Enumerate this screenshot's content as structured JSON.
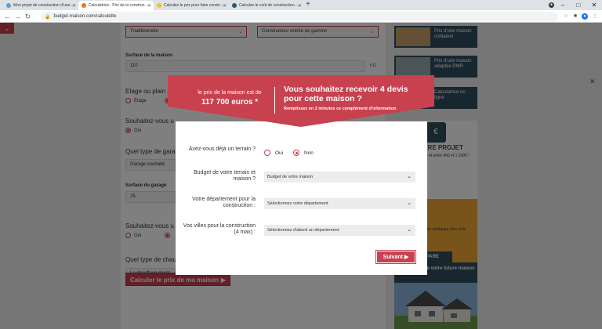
{
  "browser": {
    "tabs": [
      {
        "title": "Mon projet de construction d'une..."
      },
      {
        "title": "Calculatrice : Prix de la construc..."
      },
      {
        "title": "Calculez le prix pour faire constr..."
      },
      {
        "title": "Calculez le coût de construction ..."
      }
    ],
    "url": "budget-maison.com/calculette"
  },
  "page": {
    "style_select": "Traditionnelle",
    "builder_select": "Constructeur entrée de gamme",
    "surface_label": "Surface de la maison",
    "surface_value": "110",
    "surface_unit": "m2",
    "floor_label": "Etage ou plain p",
    "floor_opt1": "Etage",
    "q2_label": "Souhaitez-vous u",
    "q2_opt1": "Oui",
    "garage_label": "Quel type de gara",
    "garage_value": "Garage souhaité",
    "garage_surface_label": "Surface du garage",
    "garage_surface_value": "25",
    "q4_label": "Souhaitez-vous u",
    "q4_opt1": "Oui",
    "heating_label": "Quel type de chau",
    "heating_value": "Le chauffage électr",
    "calc_button": "Calculer le prix de ma maison",
    "sidebar": {
      "card1": "Prix d'une maison container",
      "card2": "Prix d'une maison adaptée PMR",
      "card3": "Calculatrice en ligne",
      "promo_title": "C VOTRE PROJET",
      "promo_sub": "s de courtage et entre 400 et 1 200€ !",
      "promo_btxt": "tenir votre emprunt, quelques clics et le meilleur taux",
      "promo_btn": "OMPARE",
      "future_title": "Prix de votre future maison neuve"
    }
  },
  "modal": {
    "price_pre": "le prix de la maison est de",
    "price": "117 700 euros *",
    "cta_title": "Vous souhaitez recevoir 4 devis pour cette maison ?",
    "cta_sub": "Remplissez en 2 minutes ce complément d'information",
    "q_terrain": "Avez-vous déjà un terrain ?",
    "opt_oui": "Oui",
    "opt_non": "Non",
    "q_budget": "Budget de votre terrain et maison ?",
    "budget_select": "Budget de votre maison",
    "q_departement": "Votre département pour la construction :",
    "departement_select": "Sélectionnez votre département",
    "q_villes": "Vos villes pour la construction (4 max) :",
    "villes_select": "Sélectionnez d'abord un département",
    "next_button": "Suivant"
  },
  "colors": {
    "accent": "#c8414f",
    "navy": "#314e5e",
    "orange": "#f0a836"
  }
}
